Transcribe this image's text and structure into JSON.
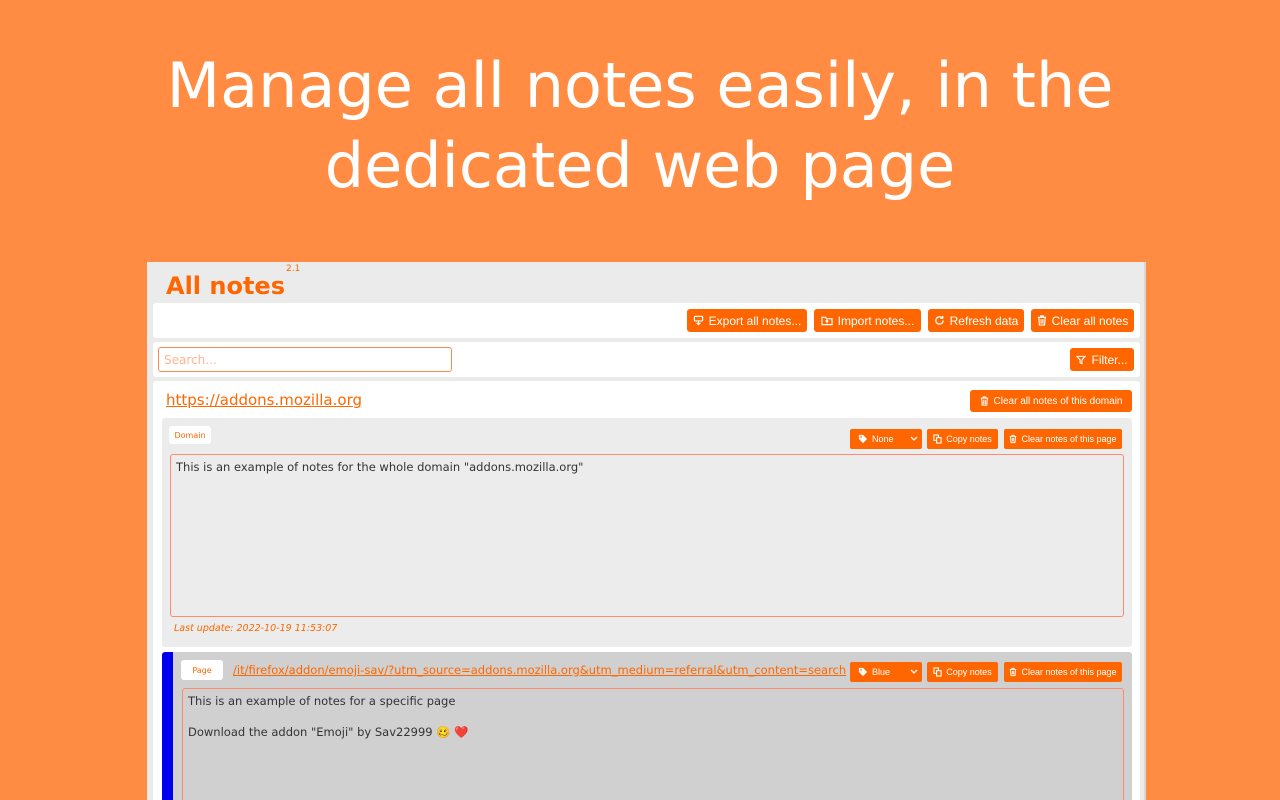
{
  "headline": {
    "line1": "Manage all notes easily, in the",
    "line2": "dedicated web page"
  },
  "app": {
    "title": "All notes",
    "version": "2.1",
    "actions": {
      "export_label": "Export all notes...",
      "import_label": "Import notes...",
      "refresh_label": "Refresh data",
      "clear_all_label": "Clear all notes"
    },
    "search": {
      "placeholder": "Search...",
      "filter_label": "Filter..."
    },
    "domain": {
      "url": "https://addons.mozilla.org",
      "clear_domain_label": "Clear all notes of this domain",
      "cards": [
        {
          "type_label": "Domain",
          "tag_label": "None",
          "copy_label": "Copy notes",
          "clear_label": "Clear notes of this page",
          "note_lines": [
            "This is an example of notes for the whole domain \"addons.mozilla.org\""
          ],
          "last_update": "Last update: 2022-10-19 11:53:07"
        },
        {
          "type_label": "Page",
          "page_url": "/it/firefox/addon/emoji-sav/?utm_source=addons.mozilla.org&utm_medium=referral&utm_content=search",
          "tag_label": "Blue",
          "tag_color": "#0000ee",
          "copy_label": "Copy notes",
          "clear_label": "Clear notes of this page",
          "note_lines": [
            "This is an example of notes for a specific page",
            "Download the addon \"Emoji\" by Sav22999 🥴 ❤️"
          ]
        }
      ]
    }
  },
  "colors": {
    "background": "#ff8c42",
    "accent": "#ff6600",
    "panel": "#ebebeb"
  }
}
